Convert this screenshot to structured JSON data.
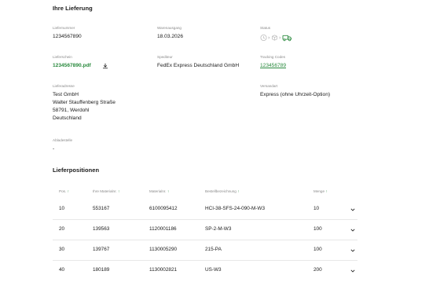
{
  "delivery": {
    "title": "Ihre Lieferung",
    "delivery_number_label": "Liefernummer",
    "delivery_number": "1234567890",
    "goods_issue_label": "Warenausgang",
    "goods_issue": "18.03.2026",
    "status_label": "Status",
    "delivery_note_label": "Lieferschein",
    "delivery_note_file": "1234567890.pdf",
    "carrier_label": "Spediteur",
    "carrier": "FedEx Express Deutschland GmbH",
    "tracking_label": "Tracking Codes",
    "tracking_code": "123456789",
    "address_label": "Lieferadresse",
    "address_lines": [
      "Test GmbH",
      "Walter Stauffenberg Straße",
      "58791, Werdohl",
      "Deutschland"
    ],
    "shipping_type_label": "Versandart",
    "shipping_type": "Express (ohne Uhrzeit-Option)",
    "unloading_point_label": "Abladestelle",
    "unloading_point": "-"
  },
  "positions": {
    "title": "Lieferpositionen",
    "columns": [
      "Pos.",
      "Ihre Materialnr.",
      "Materialnr.",
      "Bestellbezeichnung",
      "Menge"
    ],
    "rows": [
      {
        "pos": "10",
        "customer_material": "553167",
        "material": "6100095412",
        "description": "HCI-38-SFS-24-090-M-W3",
        "qty": "10"
      },
      {
        "pos": "20",
        "customer_material": "139563",
        "material": "1120001186",
        "description": "SP-2-M-W3",
        "qty": "100"
      },
      {
        "pos": "30",
        "customer_material": "139767",
        "material": "1130005290",
        "description": "215-PA",
        "qty": "100"
      },
      {
        "pos": "40",
        "customer_material": "180189",
        "material": "1130002821",
        "description": "US-W3",
        "qty": "200"
      }
    ]
  },
  "colors": {
    "accent": "#2a8a3e",
    "muted": "#8a8a8a",
    "divider": "#e8e8e8"
  },
  "icons": {
    "status": [
      "clock-icon",
      "chevron-right-icon",
      "package-icon",
      "chevron-right-icon",
      "truck-icon"
    ],
    "download": "download-icon",
    "sort": "sort-arrow-icon",
    "row_expand": "chevron-down-icon"
  }
}
